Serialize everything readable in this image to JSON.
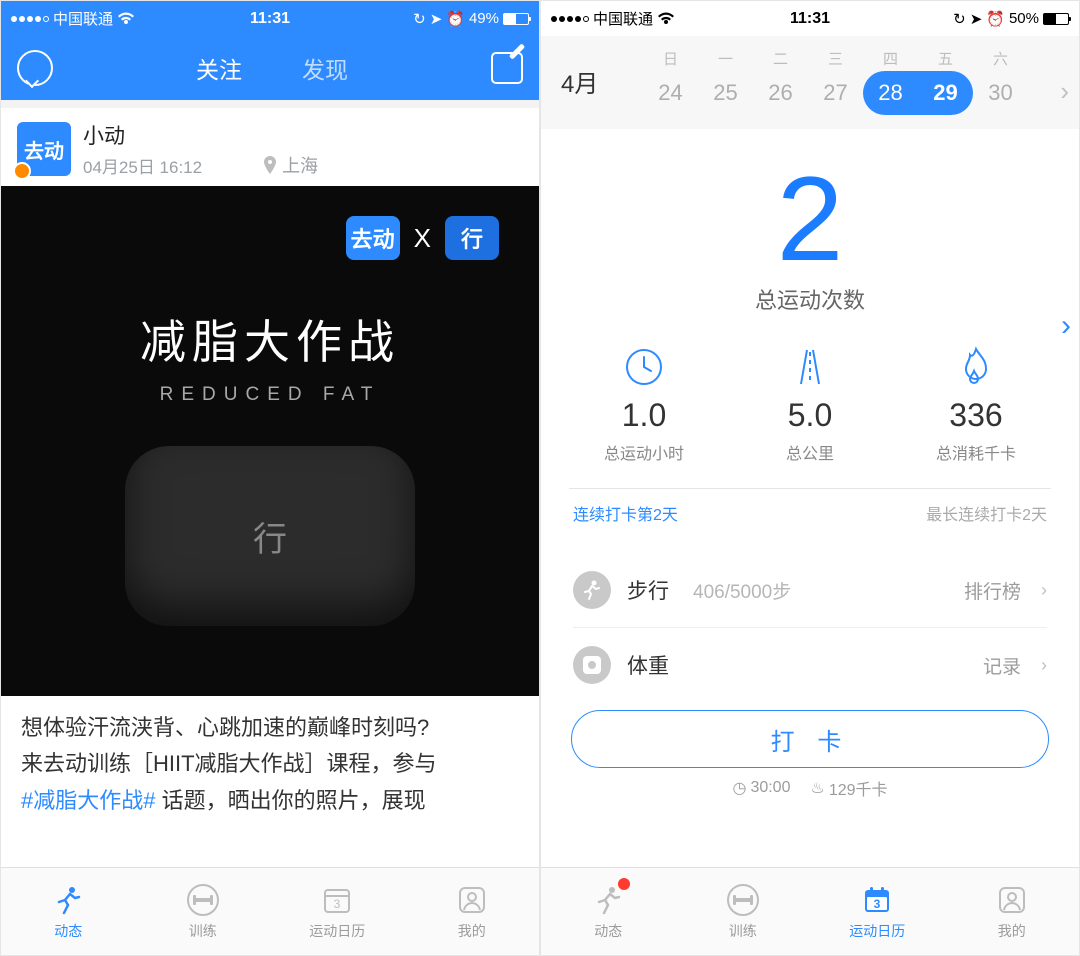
{
  "left": {
    "status": {
      "carrier": "中国联通",
      "time": "11:31",
      "battery_pct": "49%",
      "battery_fill": 49
    },
    "header": {
      "tab_follow": "关注",
      "tab_discover": "发现"
    },
    "post": {
      "avatar_text": "去动",
      "name": "小动",
      "time": "04月25日 16:12",
      "location": "上海",
      "brand_x": "X",
      "brand_a": "去动",
      "brand_b": "行",
      "hero_title": "减脂大作战",
      "hero_sub": "REDUCED FAT",
      "device_label": "行",
      "text1": "想体验汗流浃背、心跳加速的巅峰时刻吗?",
      "text2_prefix": "来去动训练［HIIT减脂大作战］课程，参与",
      "text3_topic": "#减脂大作战# ",
      "text3_rest": "话题，晒出你的照片，展现"
    },
    "tabs": {
      "feed": "动态",
      "train": "训练",
      "calendar": "运动日历",
      "mine": "我的"
    }
  },
  "right": {
    "status": {
      "carrier": "中国联通",
      "time": "11:31",
      "battery_pct": "50%",
      "battery_fill": 50
    },
    "calendar": {
      "month": "4月",
      "dows": [
        "日",
        "一",
        "二",
        "三",
        "四",
        "五",
        "六"
      ],
      "days": [
        "24",
        "25",
        "26",
        "27",
        "28",
        "29",
        "30"
      ]
    },
    "summary": {
      "count": "2",
      "count_label": "总运动次数"
    },
    "stats": {
      "hours": "1.0",
      "hours_label": "总运动小时",
      "km": "5.0",
      "km_label": "总公里",
      "kcal": "336",
      "kcal_label": "总消耗千卡"
    },
    "streak": {
      "left": "连续打卡第2天",
      "right": "最长连续打卡2天"
    },
    "walk": {
      "label": "步行",
      "progress": "406/5000步",
      "right": "排行榜"
    },
    "weight": {
      "label": "体重",
      "right": "记录"
    },
    "checkin": "打 卡",
    "subinfo": {
      "a": "30:00",
      "b": "129千卡"
    },
    "tabs": {
      "feed": "动态",
      "train": "训练",
      "calendar": "运动日历",
      "mine": "我的"
    }
  }
}
